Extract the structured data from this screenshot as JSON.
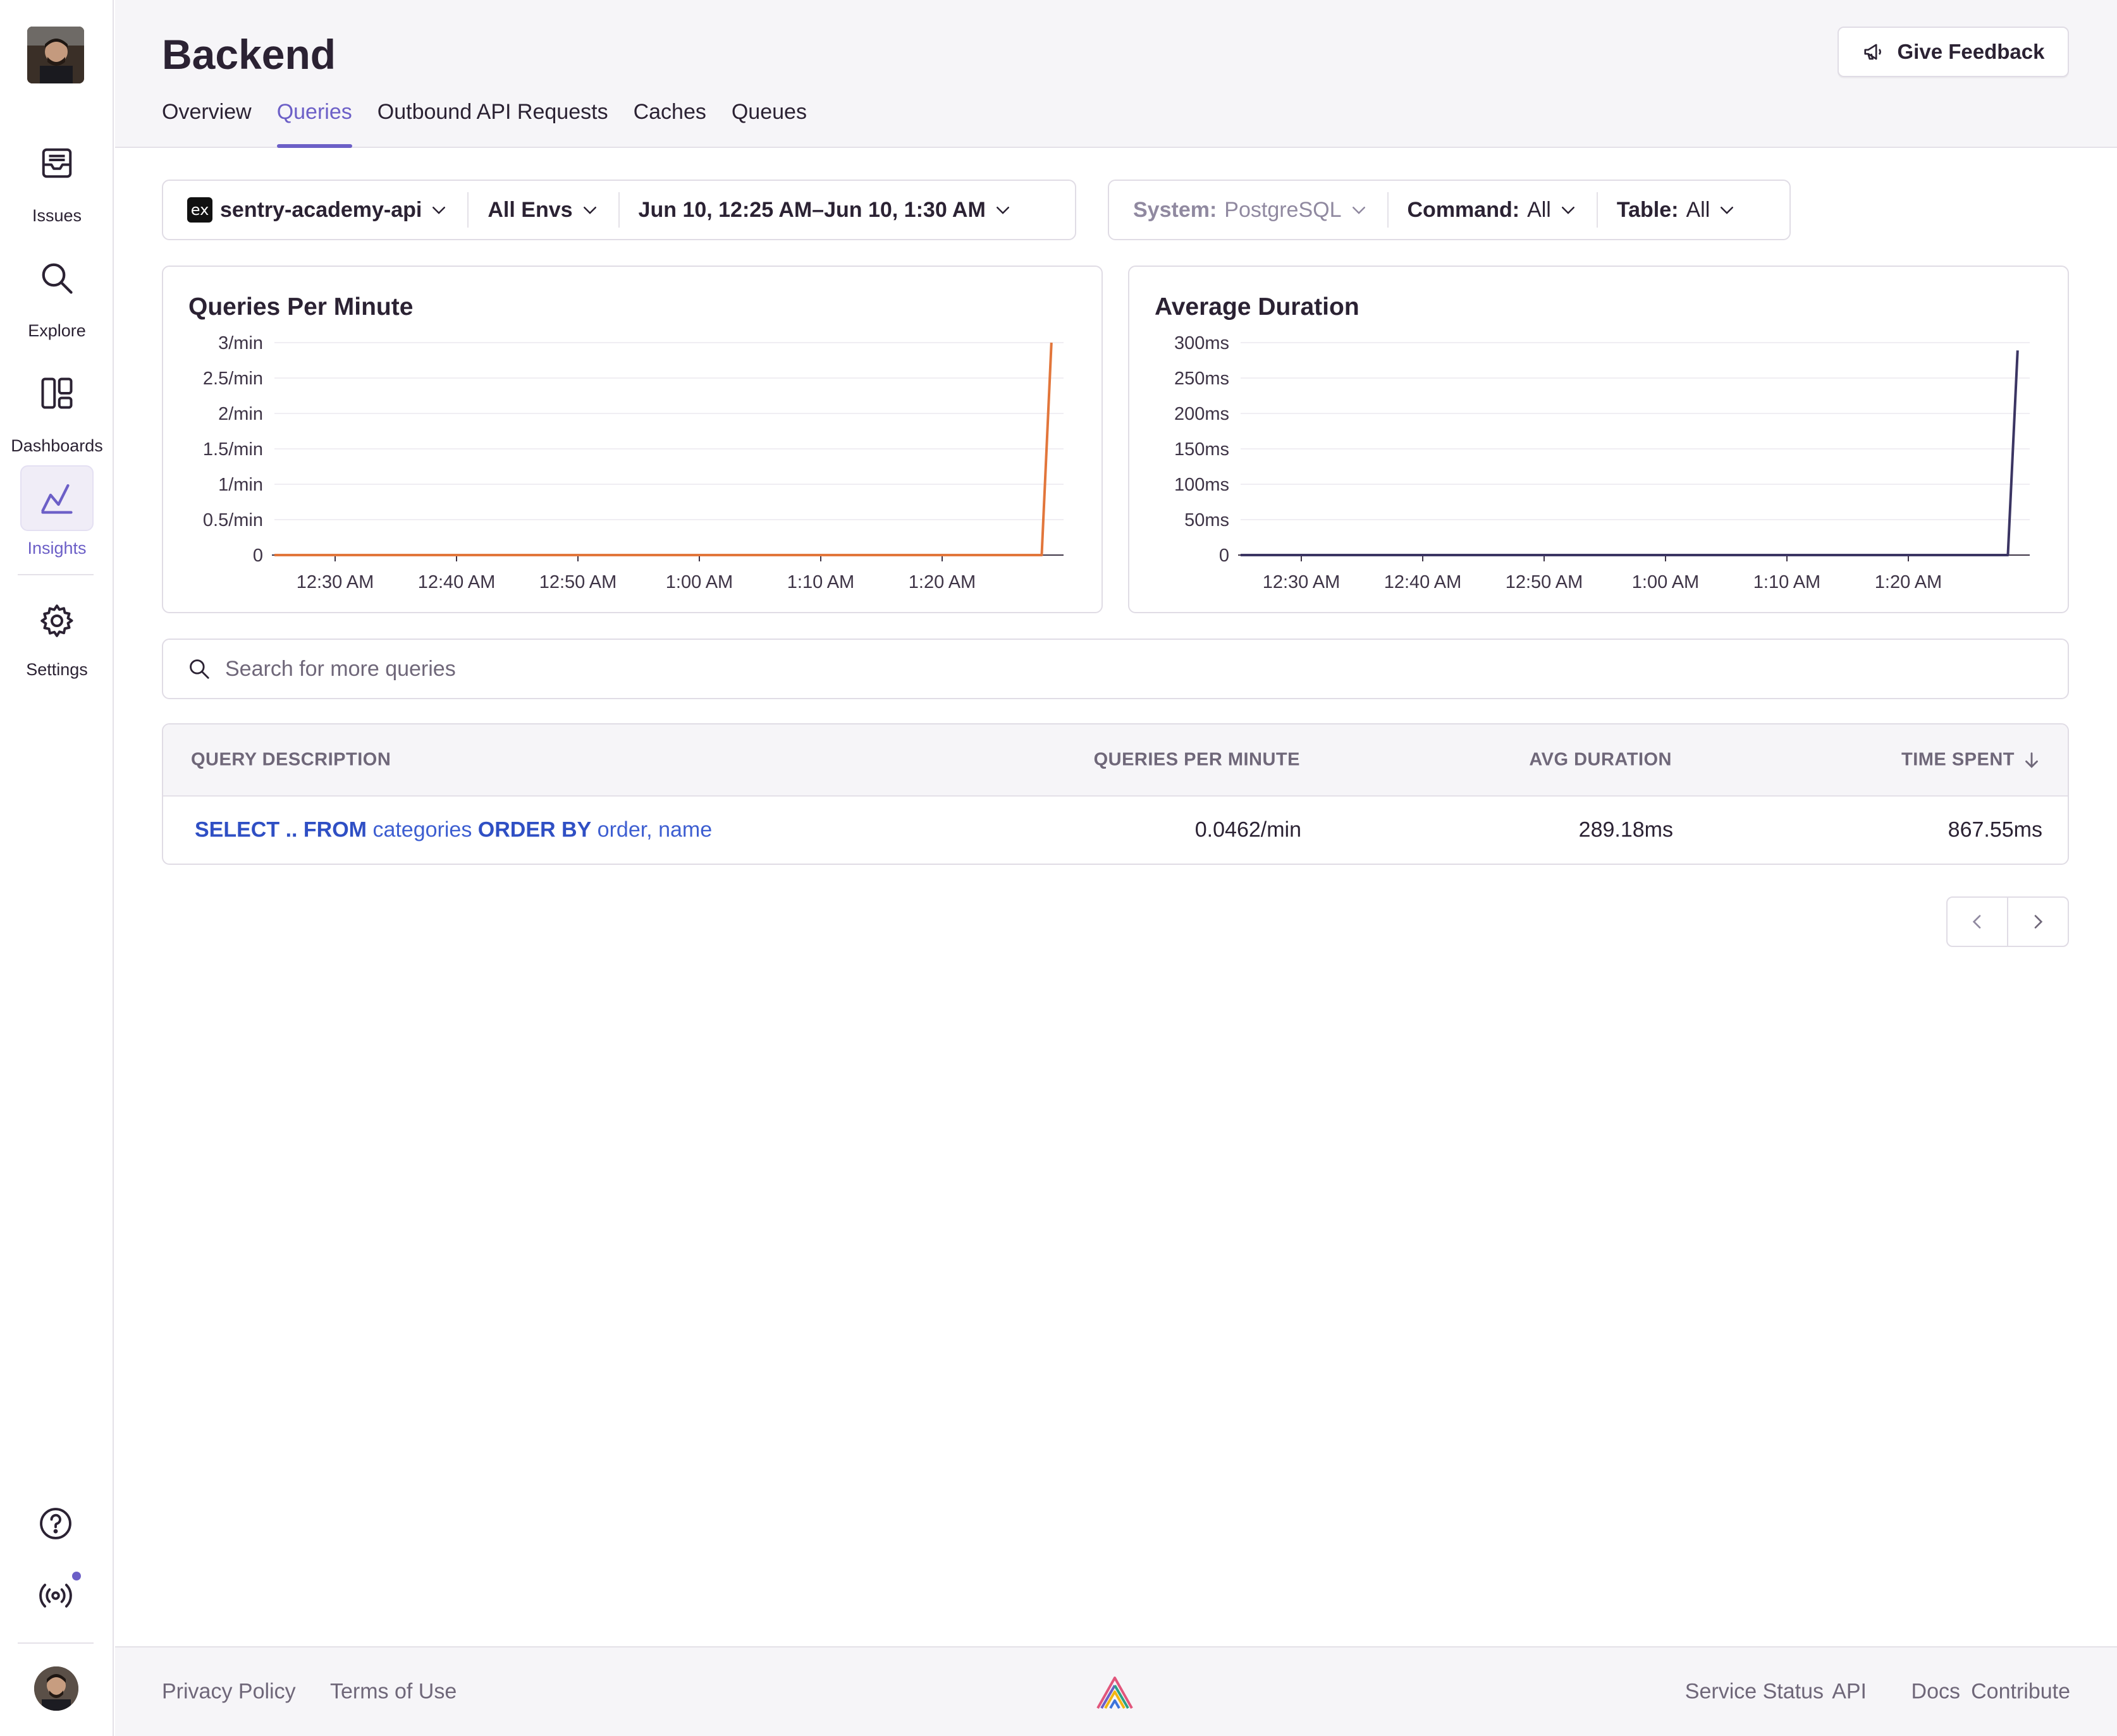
{
  "sidebar": {
    "items": [
      {
        "label": "Issues",
        "icon": "inbox-icon"
      },
      {
        "label": "Explore",
        "icon": "search-icon"
      },
      {
        "label": "Dashboards",
        "icon": "dashboards-icon"
      },
      {
        "label": "Insights",
        "icon": "insights-icon",
        "active": true
      },
      {
        "label": "Settings",
        "icon": "gear-icon"
      }
    ],
    "bottom_icons": [
      "help-icon",
      "broadcast-icon"
    ],
    "accent_color": "#6c5fc7"
  },
  "header": {
    "title": "Backend",
    "feedback_label": "Give Feedback",
    "tabs": [
      {
        "label": "Overview"
      },
      {
        "label": "Queries",
        "active": true
      },
      {
        "label": "Outbound API Requests"
      },
      {
        "label": "Caches"
      },
      {
        "label": "Queues"
      }
    ]
  },
  "filters": {
    "project": {
      "badge": "ex",
      "label": "sentry-academy-api"
    },
    "env": {
      "label": "All Envs"
    },
    "date": {
      "label": "Jun 10, 12:25 AM–Jun 10, 1:30 AM"
    },
    "system": {
      "key": "System:",
      "value": "PostgreSQL"
    },
    "command": {
      "key": "Command:",
      "value": "All"
    },
    "table": {
      "key": "Table:",
      "value": "All"
    }
  },
  "chart_data": [
    {
      "type": "line",
      "title": "Queries Per Minute",
      "x_ticks": [
        "12:30 AM",
        "12:40 AM",
        "12:50 AM",
        "1:00 AM",
        "1:10 AM",
        "1:20 AM"
      ],
      "y_ticks": [
        "3/min",
        "2.5/min",
        "2/min",
        "1.5/min",
        "1/min",
        "0.5/min",
        "0"
      ],
      "ylim": [
        0,
        3
      ],
      "color": "#e2763b",
      "series": [
        {
          "points": [
            [
              0,
              0
            ],
            [
              63.2,
              0
            ],
            [
              64,
              3
            ]
          ]
        }
      ]
    },
    {
      "type": "line",
      "title": "Average Duration",
      "x_ticks": [
        "12:30 AM",
        "12:40 AM",
        "12:50 AM",
        "1:00 AM",
        "1:10 AM",
        "1:20 AM"
      ],
      "y_ticks": [
        "300ms",
        "250ms",
        "200ms",
        "150ms",
        "100ms",
        "50ms",
        "0"
      ],
      "ylim": [
        0,
        300
      ],
      "color": "#3b3563",
      "series": [
        {
          "points": [
            [
              0,
              0
            ],
            [
              63.2,
              0
            ],
            [
              64,
              289
            ]
          ]
        }
      ]
    }
  ],
  "search": {
    "placeholder": "Search for more queries"
  },
  "table": {
    "headers": [
      "QUERY DESCRIPTION",
      "QUERIES PER MINUTE",
      "AVG DURATION",
      "TIME SPENT"
    ],
    "sort_icon": "arrow-down-icon",
    "rows": [
      {
        "query_parts": [
          "SELECT .. FROM",
          " categories ",
          "ORDER BY",
          " order, name"
        ],
        "qpm": "0.0462/min",
        "avg_duration": "289.18ms",
        "time_spent": "867.55ms"
      }
    ]
  },
  "footer": {
    "left_links": [
      "Privacy Policy",
      "Terms of Use"
    ],
    "right_links": [
      "Service Status",
      "API",
      "Docs",
      "Contribute"
    ]
  }
}
